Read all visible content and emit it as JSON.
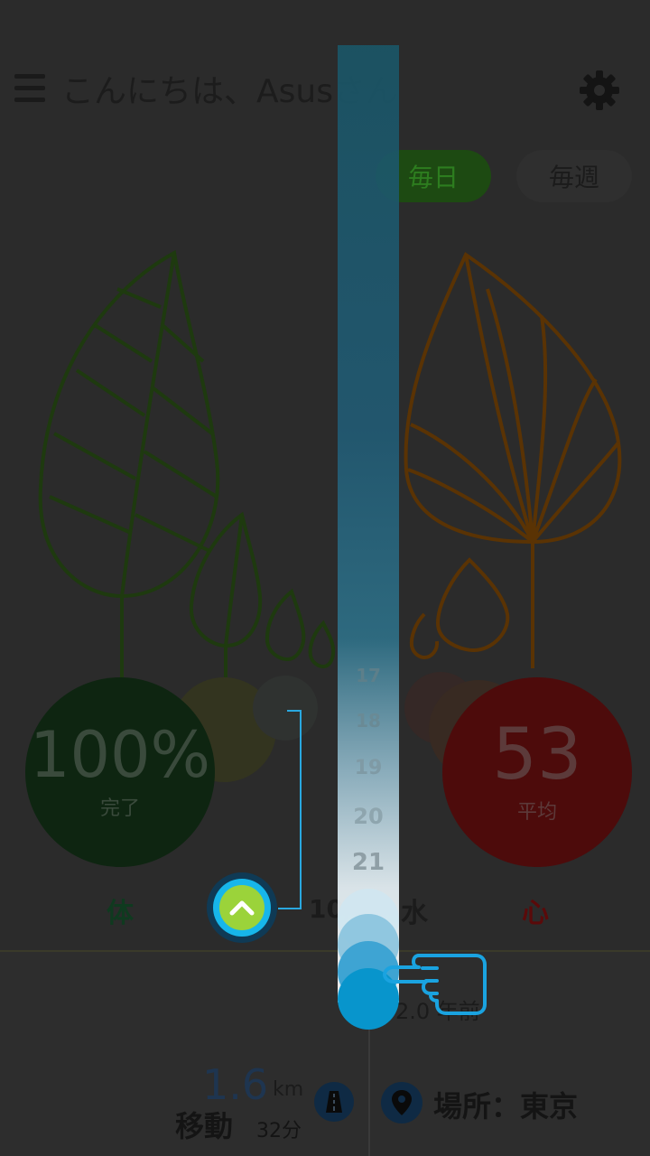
{
  "header": {
    "greeting": "こんにちは、Asusさん",
    "menu_icon": "hamburger-icon",
    "settings_icon": "gear-icon"
  },
  "toggle": {
    "daily": "毎日",
    "weekly": "毎週",
    "selected": "daily"
  },
  "body_card": {
    "value": "100%",
    "caption": "完了",
    "label": "体",
    "color": "#1f7a1f"
  },
  "heart_card": {
    "value": "53",
    "caption": "平均",
    "label": "心",
    "color": "#a11a1a"
  },
  "timeline": {
    "ticks": [
      "17",
      "18",
      "19",
      "20",
      "21"
    ],
    "date": "10/22",
    "weekday": "水",
    "scroll_icon": "chevron-up-icon",
    "pointer_icon": "hand-pointer-icon",
    "accent": "#0aa0d8"
  },
  "activity": {
    "time_ago": "2.0 年前",
    "distance_value": "1.6",
    "distance_unit": "km",
    "move_label": "移動",
    "duration": "32分",
    "road_icon": "road-icon",
    "location_icon": "location-pin-icon",
    "location": "場所：東京"
  }
}
